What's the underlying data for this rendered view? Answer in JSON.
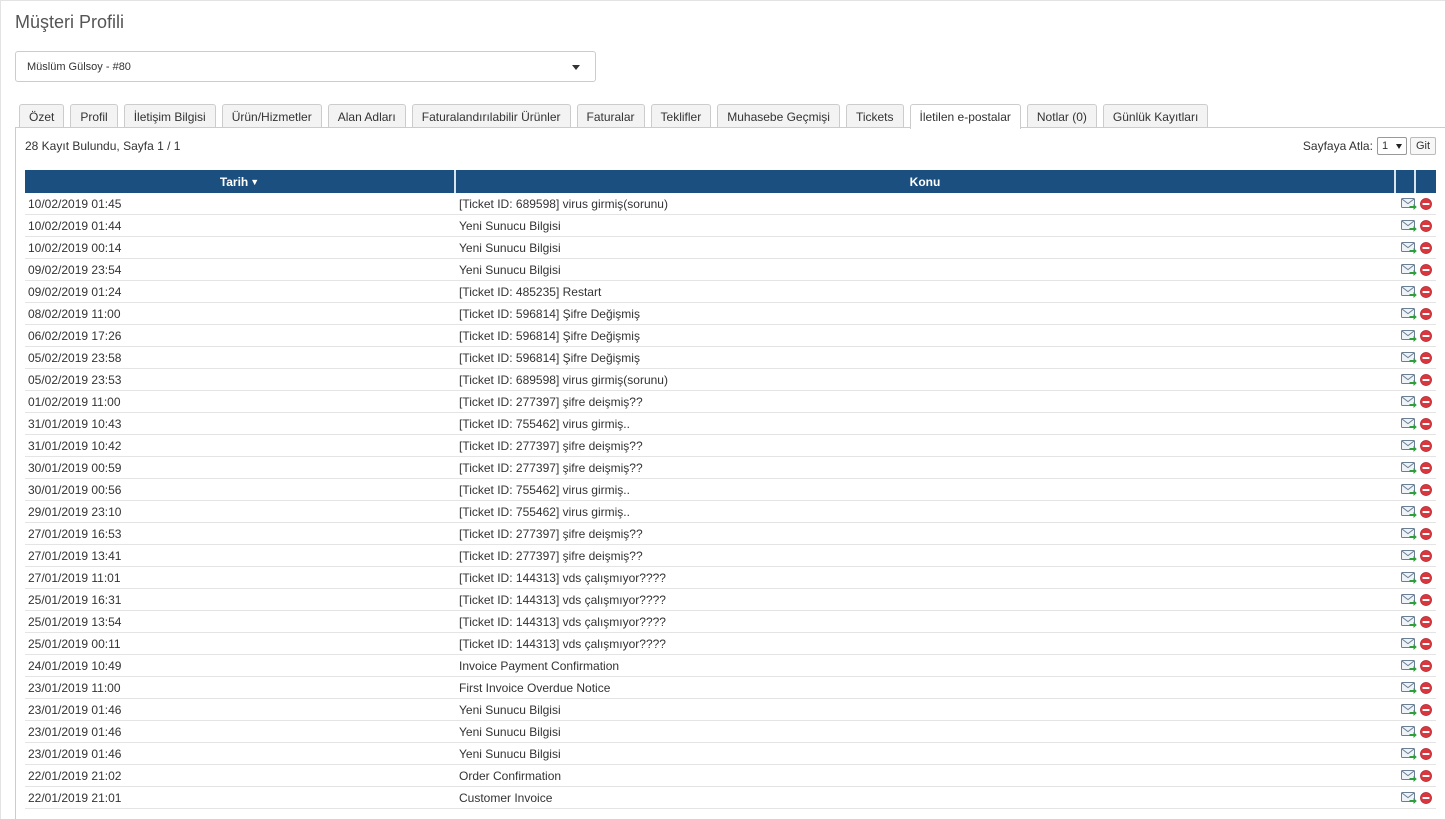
{
  "page_title": "Müşteri Profili",
  "client_selector": {
    "value": "Müslüm Gülsoy - #80"
  },
  "tabs": [
    {
      "label": "Özet"
    },
    {
      "label": "Profil"
    },
    {
      "label": "İletişim Bilgisi"
    },
    {
      "label": "Ürün/Hizmetler"
    },
    {
      "label": "Alan Adları"
    },
    {
      "label": "Faturalandırılabilir Ürünler"
    },
    {
      "label": "Faturalar"
    },
    {
      "label": "Teklifler"
    },
    {
      "label": "Muhasebe Geçmişi"
    },
    {
      "label": "Tickets"
    },
    {
      "label": "İletilen e-postalar",
      "active": true
    },
    {
      "label": "Notlar (0)"
    },
    {
      "label": "Günlük Kayıtları"
    }
  ],
  "summary": {
    "records_text": "28 Kayıt Bulundu, Sayfa 1 / 1"
  },
  "pagination": {
    "jump_label": "Sayfaya Atla:",
    "page_value": "1",
    "go_label": "Git"
  },
  "table": {
    "columns": {
      "date": "Tarih",
      "subject": "Konu",
      "sort_indicator": "▼"
    },
    "rows": [
      {
        "date": "10/02/2019 01:45",
        "subject": "[Ticket ID: 689598] virus girmiş(sorunu)"
      },
      {
        "date": "10/02/2019 01:44",
        "subject": "Yeni Sunucu Bilgisi"
      },
      {
        "date": "10/02/2019 00:14",
        "subject": "Yeni Sunucu Bilgisi"
      },
      {
        "date": "09/02/2019 23:54",
        "subject": "Yeni Sunucu Bilgisi"
      },
      {
        "date": "09/02/2019 01:24",
        "subject": "[Ticket ID: 485235] Restart"
      },
      {
        "date": "08/02/2019 11:00",
        "subject": "[Ticket ID: 596814] Şifre Değişmiş"
      },
      {
        "date": "06/02/2019 17:26",
        "subject": "[Ticket ID: 596814] Şifre Değişmiş"
      },
      {
        "date": "05/02/2019 23:58",
        "subject": "[Ticket ID: 596814] Şifre Değişmiş"
      },
      {
        "date": "05/02/2019 23:53",
        "subject": "[Ticket ID: 689598] virus girmiş(sorunu)"
      },
      {
        "date": "01/02/2019 11:00",
        "subject": "[Ticket ID: 277397] şifre deişmiş??"
      },
      {
        "date": "31/01/2019 10:43",
        "subject": "[Ticket ID: 755462] virus girmiş.."
      },
      {
        "date": "31/01/2019 10:42",
        "subject": "[Ticket ID: 277397] şifre deişmiş??"
      },
      {
        "date": "30/01/2019 00:59",
        "subject": "[Ticket ID: 277397] şifre deişmiş??"
      },
      {
        "date": "30/01/2019 00:56",
        "subject": "[Ticket ID: 755462] virus girmiş.."
      },
      {
        "date": "29/01/2019 23:10",
        "subject": "[Ticket ID: 755462] virus girmiş.."
      },
      {
        "date": "27/01/2019 16:53",
        "subject": "[Ticket ID: 277397] şifre deişmiş??"
      },
      {
        "date": "27/01/2019 13:41",
        "subject": "[Ticket ID: 277397] şifre deişmiş??"
      },
      {
        "date": "27/01/2019 11:01",
        "subject": "[Ticket ID: 144313] vds çalışmıyor????"
      },
      {
        "date": "25/01/2019 16:31",
        "subject": "[Ticket ID: 144313] vds çalışmıyor????"
      },
      {
        "date": "25/01/2019 13:54",
        "subject": "[Ticket ID: 144313] vds çalışmıyor????"
      },
      {
        "date": "25/01/2019 00:11",
        "subject": "[Ticket ID: 144313] vds çalışmıyor????"
      },
      {
        "date": "24/01/2019 10:49",
        "subject": "Invoice Payment Confirmation"
      },
      {
        "date": "23/01/2019 11:00",
        "subject": "First Invoice Overdue Notice"
      },
      {
        "date": "23/01/2019 01:46",
        "subject": "Yeni Sunucu Bilgisi"
      },
      {
        "date": "23/01/2019 01:46",
        "subject": "Yeni Sunucu Bilgisi"
      },
      {
        "date": "23/01/2019 01:46",
        "subject": "Yeni Sunucu Bilgisi"
      },
      {
        "date": "22/01/2019 21:02",
        "subject": "Order Confirmation"
      },
      {
        "date": "22/01/2019 21:01",
        "subject": "Customer Invoice"
      }
    ]
  },
  "icons": {
    "resend": "email-resend-icon",
    "delete": "delete-icon"
  },
  "colors": {
    "header_bg": "#1b4f7f",
    "delete_red": "#d9363e",
    "resend_green": "#2e9e3a"
  }
}
